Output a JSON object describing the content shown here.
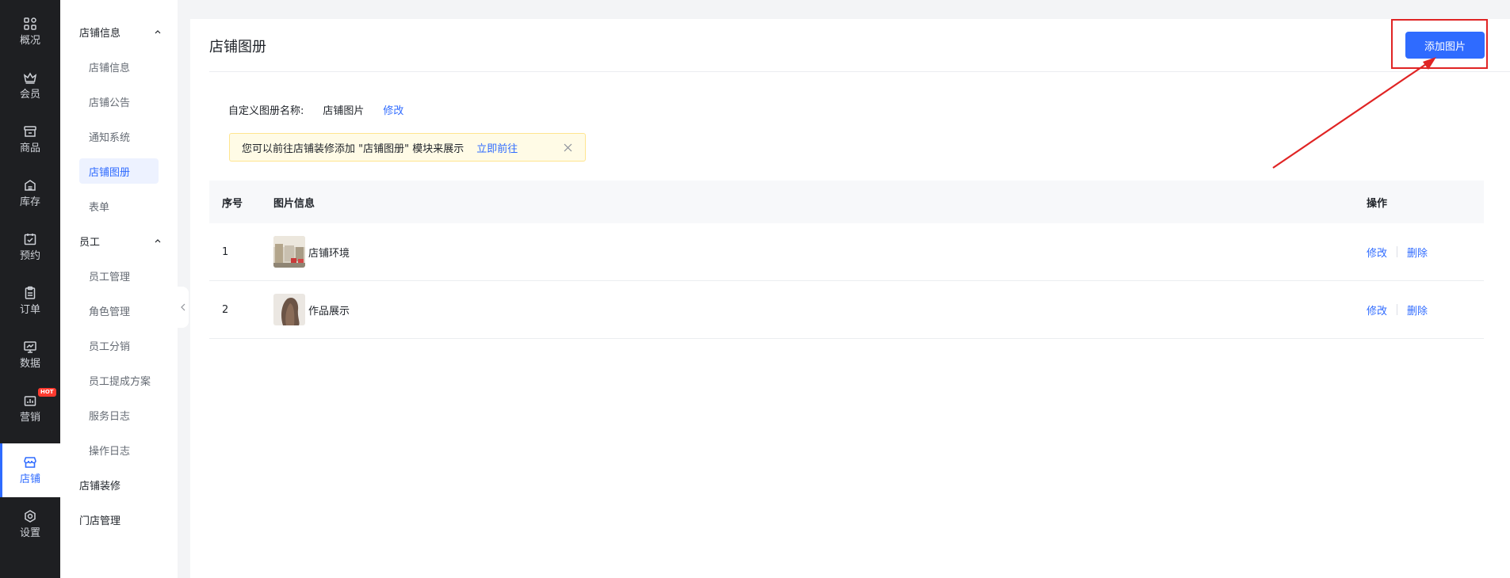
{
  "primary_nav": [
    {
      "label": "概况",
      "icon": "grid-icon"
    },
    {
      "label": "会员",
      "icon": "crown-icon"
    },
    {
      "label": "商品",
      "icon": "store-icon"
    },
    {
      "label": "库存",
      "icon": "inventory-icon"
    },
    {
      "label": "预约",
      "icon": "calendar-check-icon"
    },
    {
      "label": "订单",
      "icon": "clipboard-icon"
    },
    {
      "label": "数据",
      "icon": "chart-monitor-icon"
    },
    {
      "label": "营销",
      "icon": "bar-chart-icon",
      "badge": "HOT"
    },
    {
      "label": "店铺",
      "icon": "shop-icon",
      "active": true
    },
    {
      "label": "设置",
      "icon": "gear-icon"
    }
  ],
  "secondary_nav": {
    "group_store": "店铺信息",
    "store_items": [
      "店铺信息",
      "店铺公告",
      "通知系统",
      "店铺图册",
      "表单"
    ],
    "group_staff": "员工",
    "staff_items": [
      "员工管理",
      "角色管理",
      "员工分销",
      "员工提成方案",
      "服务日志",
      "操作日志"
    ],
    "store_decor": "店铺装修",
    "shop_manage": "门店管理"
  },
  "page": {
    "title": "店铺图册",
    "add_button": "添加图片",
    "album_label": "自定义图册名称:",
    "album_name": "店铺图片",
    "album_edit": "修改",
    "notice_text": "您可以前往店铺装修添加 \"店铺图册\" 模块来展示",
    "notice_link": "立即前往"
  },
  "table": {
    "headers": {
      "index": "序号",
      "info": "图片信息",
      "ops": "操作"
    },
    "rows": [
      {
        "index": "1",
        "name": "店铺环境",
        "edit": "修改",
        "delete": "删除"
      },
      {
        "index": "2",
        "name": "作品展示",
        "edit": "修改",
        "delete": "删除"
      }
    ]
  },
  "colors": {
    "accent": "#2f6bff",
    "sidebar_bg": "#1e1f22",
    "annotation": "#e02424",
    "notice_bg": "#fffbe6"
  }
}
